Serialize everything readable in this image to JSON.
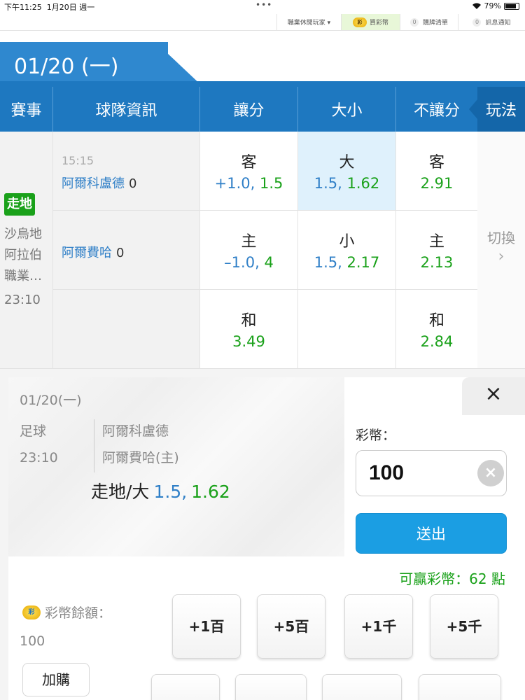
{
  "status": {
    "time": "下午11:25",
    "date": "1月20日 週一",
    "battery": "79%"
  },
  "topnav": {
    "players": "職業休閒玩家 ▾",
    "coin_badge": "彩",
    "coin": "買彩幣",
    "cart_count": "0",
    "cart": "購牌清單",
    "msg_count": "0",
    "msg": "訊息通知"
  },
  "date_tab": "01/20 (一)",
  "headers": {
    "event": "賽事",
    "team": "球隊資訊",
    "handicap": "讓分",
    "over_under": "大小",
    "moneyline": "不讓分",
    "play": "玩法"
  },
  "event": {
    "badge": "走地",
    "league": "沙烏地阿拉伯職業…",
    "time": "23:10"
  },
  "teams": [
    {
      "kickoff": "15:15",
      "name": "阿爾科盧德",
      "score": "0"
    },
    {
      "name": "阿爾費哈",
      "score": "0"
    }
  ],
  "odds": {
    "handicap": [
      {
        "label": "客",
        "line": "+1.0,",
        "price": "1.5"
      },
      {
        "label": "主",
        "line": "–1.0,",
        "price": "4"
      },
      {
        "label": "和",
        "line": "",
        "price": "3.49"
      }
    ],
    "over_under": [
      {
        "label": "大",
        "line": "1.5,",
        "price": "1.62"
      },
      {
        "label": "小",
        "line": "1.5,",
        "price": "2.17"
      }
    ],
    "moneyline": [
      {
        "label": "客",
        "price": "2.91"
      },
      {
        "label": "主",
        "price": "2.13"
      },
      {
        "label": "和",
        "price": "2.84"
      }
    ]
  },
  "switch": {
    "label": "切換",
    "chevron": "›"
  },
  "slip": {
    "date": "01/20(一)",
    "sport": "足球",
    "time": "23:10",
    "home": "阿爾科盧德",
    "away": "阿爾費哈(主)",
    "pick": "走地/大",
    "pick_line": "1.5,",
    "pick_price": "1.62",
    "close": "×",
    "amount_label": "彩幣：",
    "amount": "100",
    "clear": "×",
    "submit": "送出",
    "win": "可贏彩幣：62 點",
    "balance_icon": "彩",
    "balance_label": "彩幣餘額：",
    "balance": "100",
    "buy": "加購",
    "chips": [
      "+1百",
      "+5百",
      "+1千",
      "+5千"
    ]
  }
}
